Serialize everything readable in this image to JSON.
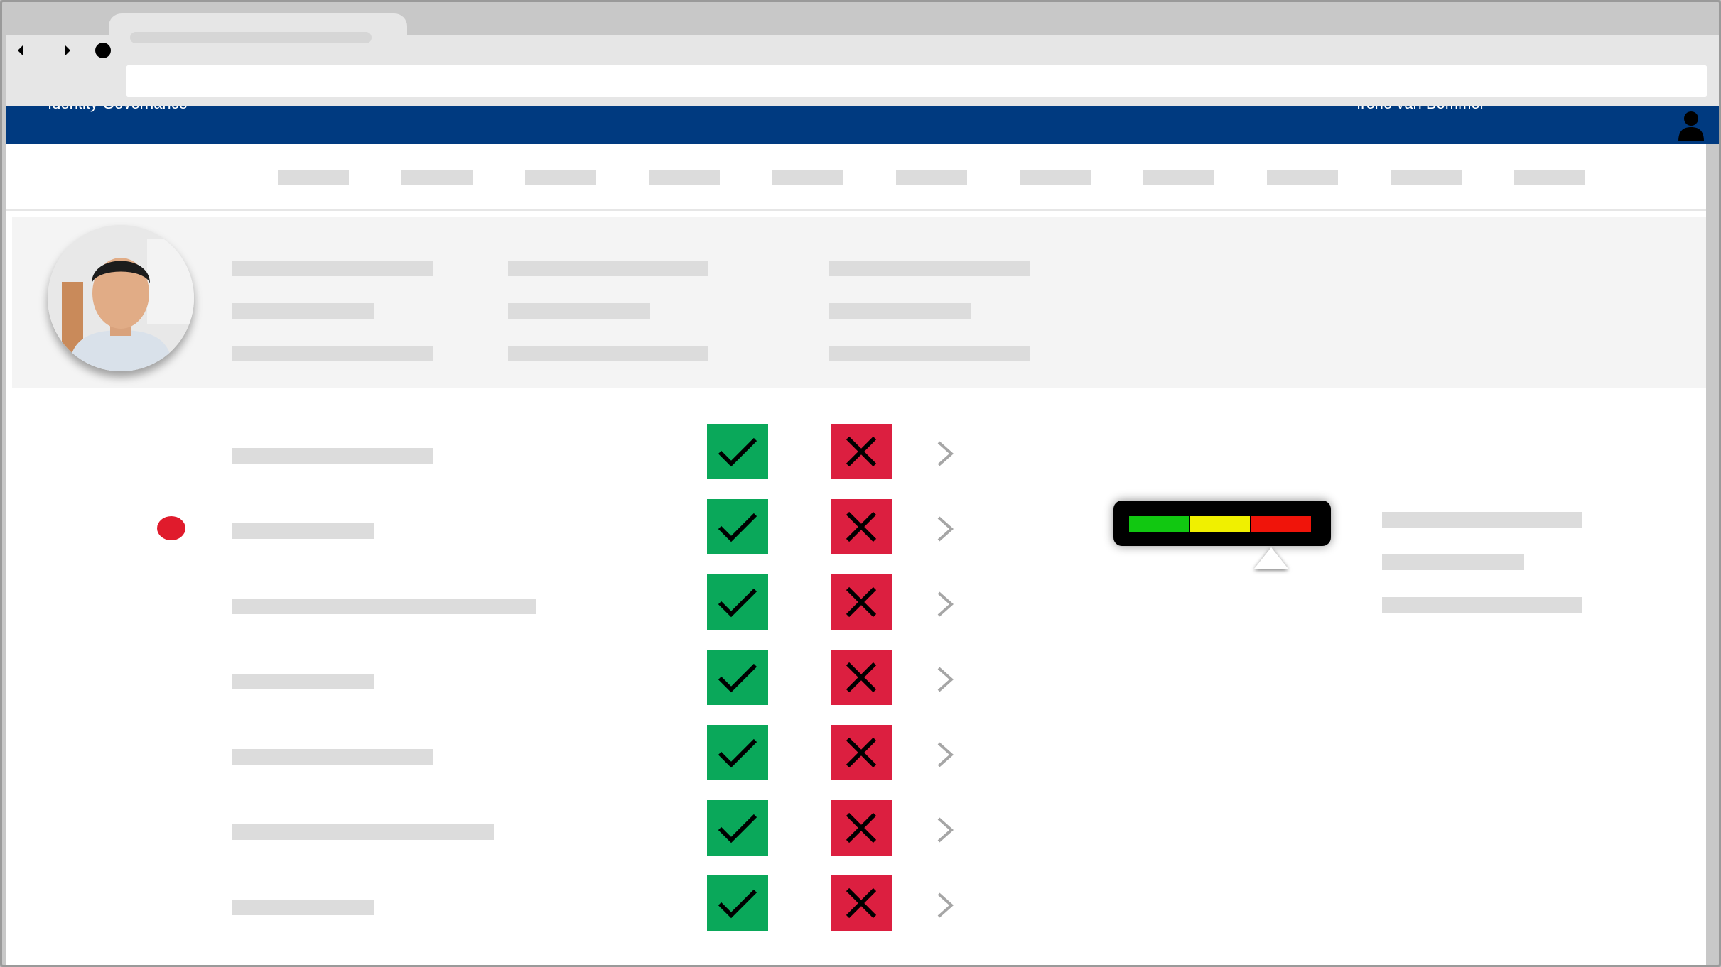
{
  "header": {
    "app_title": "Identity Governance",
    "user_name": "Irene van Bommel"
  },
  "risk_meter": {
    "segments": [
      {
        "color": "#11c811"
      },
      {
        "color": "#f0f000"
      },
      {
        "color": "#f0140a"
      }
    ]
  },
  "colors": {
    "header": "#003a80",
    "approve": "#0aa85a",
    "reject": "#dc1f40",
    "flag": "#e01b2c"
  },
  "rows": [
    {
      "flagged": false
    },
    {
      "flagged": true
    },
    {
      "flagged": false
    },
    {
      "flagged": false
    },
    {
      "flagged": false
    },
    {
      "flagged": false
    },
    {
      "flagged": false
    }
  ]
}
